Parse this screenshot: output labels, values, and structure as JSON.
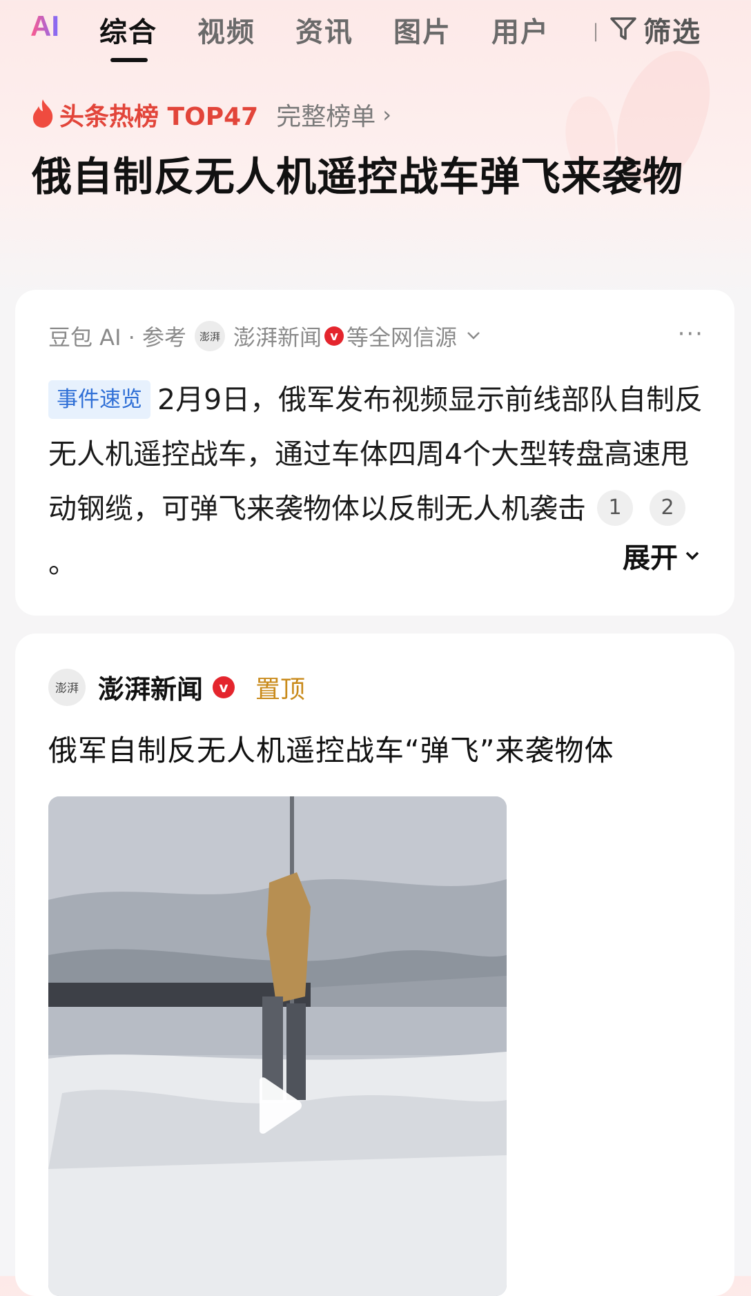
{
  "tabs": {
    "ai": "AI",
    "items": [
      "综合",
      "视频",
      "资讯",
      "图片",
      "用户"
    ],
    "active_index": 0,
    "filter_label": "筛选"
  },
  "hot": {
    "label": "头条热榜 TOP47",
    "full_list": "完整榜单"
  },
  "headline": "俄自制反无人机遥控战车弹飞来袭物",
  "ai_card": {
    "source_prefix": "豆包 AI · 参考",
    "source_logo_text": "澎湃",
    "source_name": "澎湃新闻",
    "source_suffix": "等全网信源",
    "tag": "事件速览",
    "summary": "2月9日，俄军发布视频显示前线部队自制反无人机遥控战车，通过车体四周4个大型转盘高速甩动钢缆，可弹飞来袭物体以反制无人机袭击",
    "citations": [
      "1",
      "2"
    ],
    "period": "。",
    "expand_label": "展开"
  },
  "article": {
    "publisher_logo_text": "澎湃",
    "publisher": "澎湃新闻",
    "pinned": "置顶",
    "title": "俄军自制反无人机遥控战车“弹飞”来袭物体"
  },
  "colors": {
    "accent_red": "#e2453a",
    "tag_blue": "#2f6fd6",
    "pinned_gold": "#c98a1a"
  }
}
